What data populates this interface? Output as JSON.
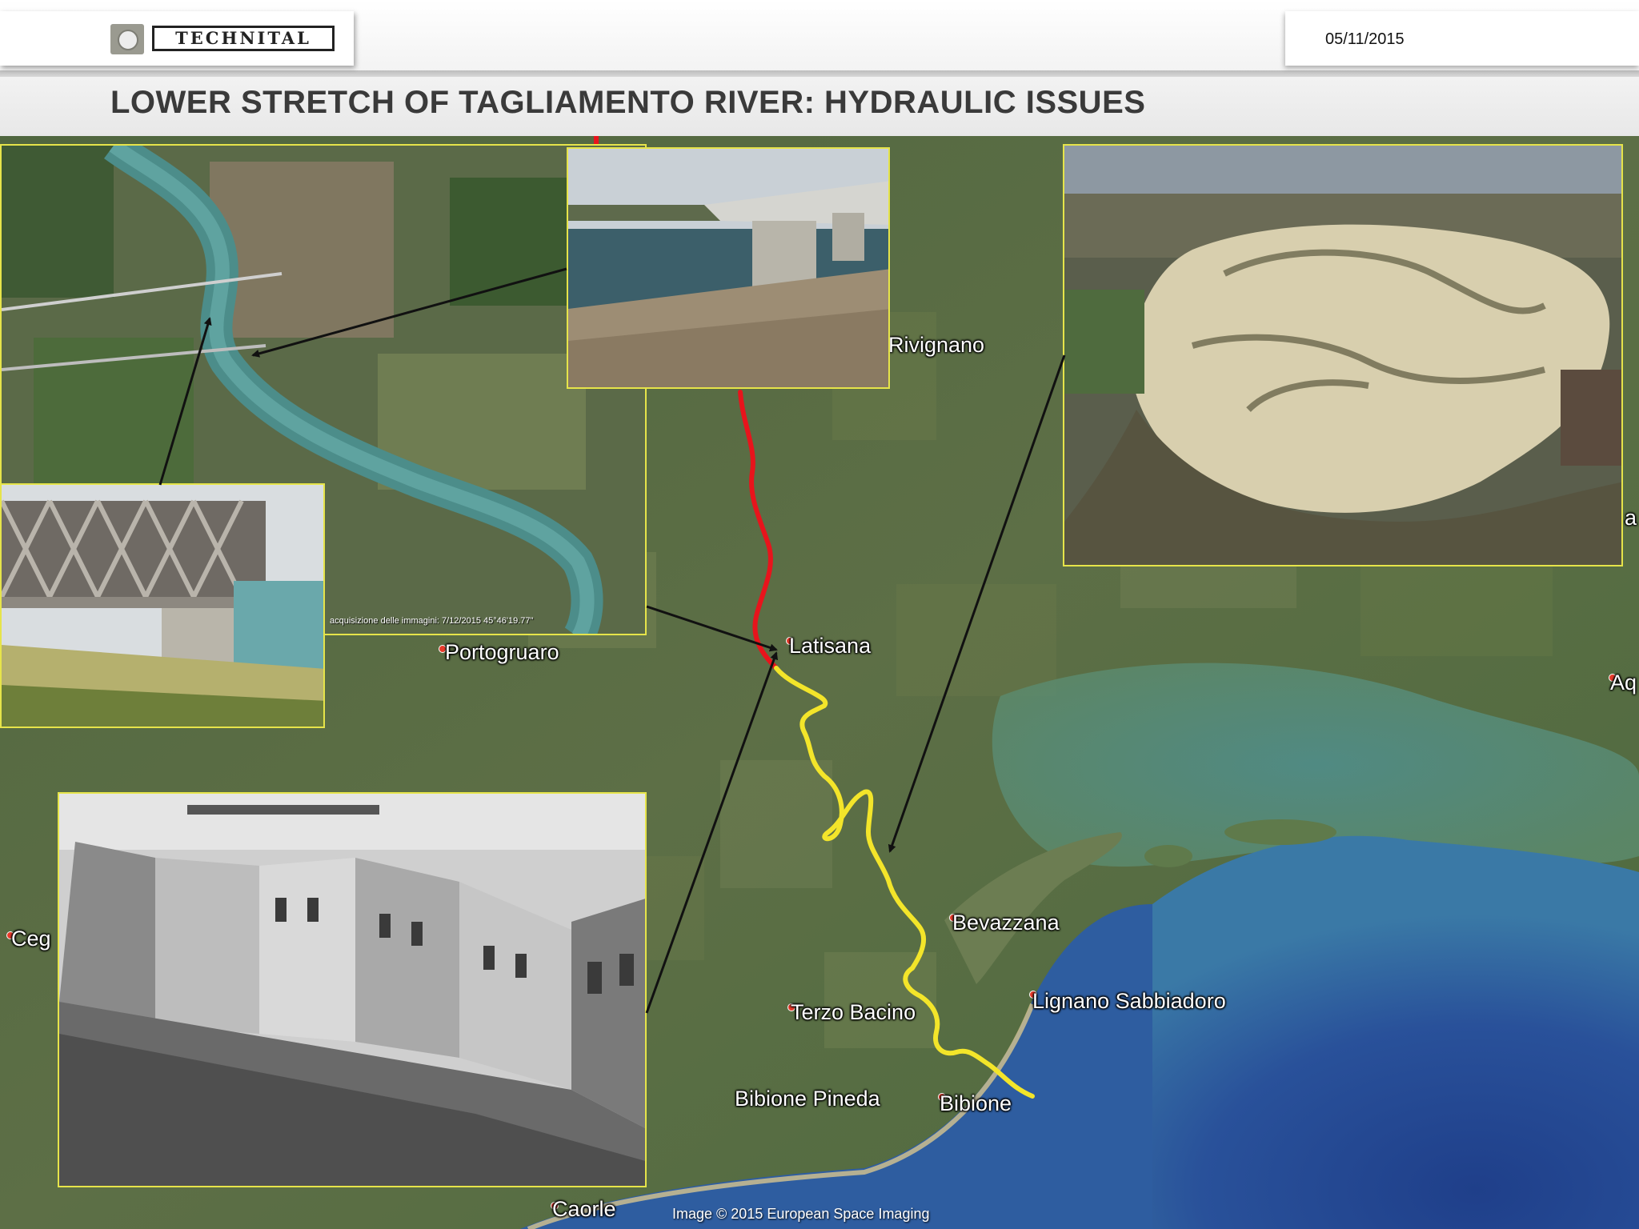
{
  "header": {
    "logo_text": "TECHNITAL",
    "date": "05/11/2015",
    "title": "LOWER STRETCH OF TAGLIAMENTO RIVER: HYDRAULIC ISSUES"
  },
  "map": {
    "places": {
      "rivignano": "Rivignano",
      "latisana": "Latisana",
      "portogruaro": "Portogruaro",
      "bevazzana": "Bevazzana",
      "lignano": "Lignano Sabbiadoro",
      "terzo_bacino": "Terzo Bacino",
      "bibione_pineda": "Bibione Pineda",
      "bibione": "Bibione",
      "caorle": "Caorle",
      "ceg": "Ceg",
      "aq": "Aq",
      "edge_a": "a"
    },
    "credit": "Image © 2015 European Space Imaging",
    "photo_caption": "acquisizione delle immagini: 7/12/2015      45°46'19.77\"",
    "river_colors": {
      "upstream": "#e8141c",
      "downstream": "#f3e52a"
    },
    "frame_color": "#e6e44a",
    "arrow_color": "#111111"
  }
}
